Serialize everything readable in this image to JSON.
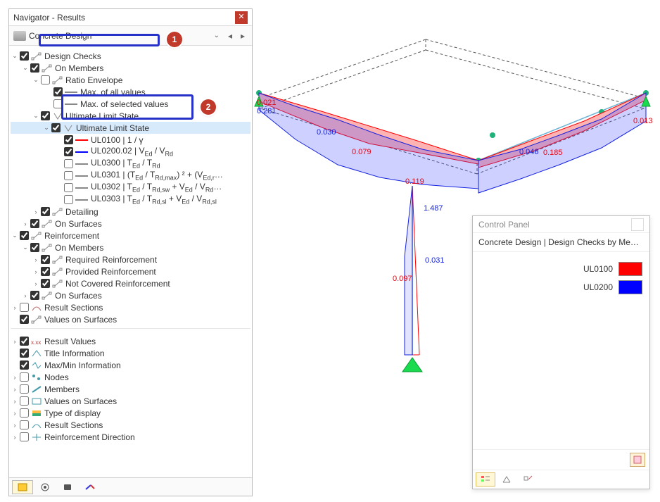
{
  "navigator": {
    "title": "Navigator - Results",
    "category": "Concrete Design",
    "tree": {
      "design_checks": "Design Checks",
      "on_members": "On Members",
      "ratio_envelope": "Ratio Envelope",
      "max_all": "Max. of all values",
      "max_sel": "Max. of selected values",
      "uls": "Ultimate Limit State",
      "uls2": "Ultimate Limit State",
      "ul0100": "UL0100 | 1 / γ",
      "ul0200": "UL0200.02 | VEd / VRd",
      "ul0300": "UL0300 | TEd / TRd",
      "ul0301": "UL0301 | (TEd / TRd,max) ² + (VEd,r…",
      "ul0302": "UL0302 | TEd / TRd,sw + VEd / VRd…",
      "ul0303": "UL0303 | TEd / TRd,sl + VEd / VRd,sl",
      "detailing": "Detailing",
      "on_surfaces": "On Surfaces",
      "reinforcement": "Reinforcement",
      "req_reinf": "Required Reinforcement",
      "prov_reinf": "Provided Reinforcement",
      "notcov_reinf": "Not Covered Reinforcement",
      "result_sections": "Result Sections",
      "values_surfaces": "Values on Surfaces",
      "result_values": "Result Values",
      "title_info": "Title Information",
      "maxmin": "Max/Min Information",
      "nodes": "Nodes",
      "members": "Members",
      "type_display": "Type of display",
      "result_sections2": "Result Sections",
      "reinf_dir": "Reinforcement Direction"
    }
  },
  "viewport": {
    "values": {
      "v1": "0.021",
      "v2": "0.281",
      "v3": "0.030",
      "v4": "0.079",
      "v5": "0.013",
      "v6": "0.046",
      "v7": "0.185",
      "v8": "0.119",
      "v9": "1.487",
      "v10": "0.031",
      "v11": "0.097"
    }
  },
  "control_panel": {
    "title": "Control Panel",
    "subtitle": "Concrete Design | Design Checks by Members",
    "legend": [
      {
        "code": "UL0100",
        "color": "#ff0000"
      },
      {
        "code": "UL0200",
        "color": "#0000ff"
      }
    ]
  }
}
